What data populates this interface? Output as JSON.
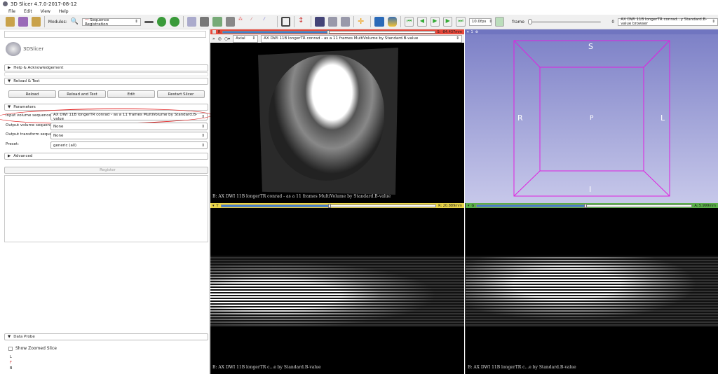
{
  "app": {
    "title": "3D Slicer 4.7.0-2017-08-12",
    "menu": [
      "File",
      "Edit",
      "View",
      "Help"
    ]
  },
  "toolbar": {
    "modules_label": "Modules:",
    "module": "Sequence Registration",
    "fps": "10.0fps",
    "frame_label": "frame",
    "frame_value": "0",
    "browser": "AX DWI 11B longerTR conrad...y Standard.B-value browser"
  },
  "left": {
    "logo": "3DSlicer",
    "sections": {
      "help": "Help & Acknowledgement",
      "reload": "Reload & Test",
      "parameters": "Parameters",
      "advanced": "Advanced",
      "data_probe": "Data Probe"
    },
    "buttons": [
      "Reload",
      "Reload and Test",
      "Edit",
      "Restart Slicer"
    ],
    "params": [
      {
        "label": "Input volume sequence:",
        "value": "AX DWI 11B longerTR conrad - as a 11 frames MultiVolume by Standard.B-value"
      },
      {
        "label": "Output volume sequence:",
        "value": "None"
      },
      {
        "label": "Output transform sequence:",
        "value": "None"
      },
      {
        "label": "Preset:",
        "value": "generic (all)"
      }
    ],
    "register": "Register",
    "probe": {
      "checkbox": "Show Zoomed Slice",
      "lines": [
        "L",
        "F",
        "B"
      ]
    }
  },
  "views": {
    "red": {
      "letter": "R",
      "offset": "S: -84.437mm",
      "orientation": "Axial",
      "volume": "AX DWI 11B longerTR conrad - as a 11 frames MultiVolume by Standard.B-value",
      "label": "B: AX DWI 11B longerTR conrad - as a 11 frames MultiVolume by Standard.B-value",
      "slider": 0.5,
      "color": "#e8483a"
    },
    "three_d": {
      "letter": "1",
      "axes": {
        "s": "S",
        "r": "R",
        "l": "L",
        "p": "P",
        "i": "I"
      }
    },
    "yellow": {
      "letter": "Y",
      "offset": "R: 20.889mm",
      "label": "B: AX DWI 11B longerTR c...e by Standard.B-value",
      "slider": 0.5,
      "color": "#e8d44a"
    },
    "green": {
      "letter": "G",
      "offset": "A: 5.999mm",
      "label": "B: AX DWI 11B longerTR c...e by Standard.B-value",
      "slider": 0.5,
      "color": "#5cb04a"
    }
  }
}
